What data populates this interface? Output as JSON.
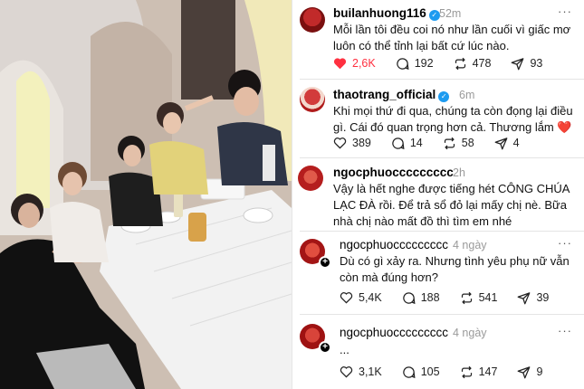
{
  "posts": [
    {
      "username": "builanhuong116",
      "verified": true,
      "time": "52m",
      "text": "Mỗi lần tôi đều coi nó như lần cuối vì giấc mơ luôn có thể tỉnh lại bất cứ lúc nào.",
      "likes": "2,6K",
      "liked": true,
      "comments": "192",
      "reposts": "478",
      "shares": "93"
    },
    {
      "username": "thaotrang_official",
      "verified": true,
      "time": "6m",
      "text": "Khi mọi thứ đi qua, chúng ta còn đọng lại điều gì. Cái đó quan trọng hơn cả. Thương lắm ❤️",
      "likes": "389",
      "comments": "14",
      "reposts": "58",
      "shares": "4"
    },
    {
      "username": "ngocphuoccccccccc",
      "verified": false,
      "time": "2h",
      "text": "Vậy là hết nghe được tiếng hét CÔNG CHÚA LẠC ĐÀ rồi. Để trả sổ đỏ lại mấy chị nè. Bữa nhà chị nào mất đồ thì tìm em nhé"
    },
    {
      "username": "ngocphuoccccccccc",
      "verified": false,
      "time": "4 ngày",
      "text": "Dù có gì xảy ra. Nhưng tình yêu phụ nữ vẫn còn mà đúng hơn?",
      "likes": "5,4K",
      "comments": "188",
      "reposts": "541",
      "shares": "39"
    },
    {
      "username": "ngocphuoccccccccc",
      "verified": false,
      "time": "4 ngày",
      "text": "...",
      "likes": "3,1K",
      "comments": "105",
      "reposts": "147",
      "shares": "9"
    }
  ],
  "ui": {
    "more_glyph": "···",
    "plus_glyph": "+",
    "verified_glyph": "✓"
  },
  "colors": {
    "like_active": "#ff3040",
    "verified": "#1d9bf0",
    "meta_gray": "#9a9a9a"
  },
  "icons": [
    "heart-icon",
    "comment-icon",
    "repost-icon",
    "share-icon",
    "more-icon",
    "follow-plus-icon"
  ]
}
